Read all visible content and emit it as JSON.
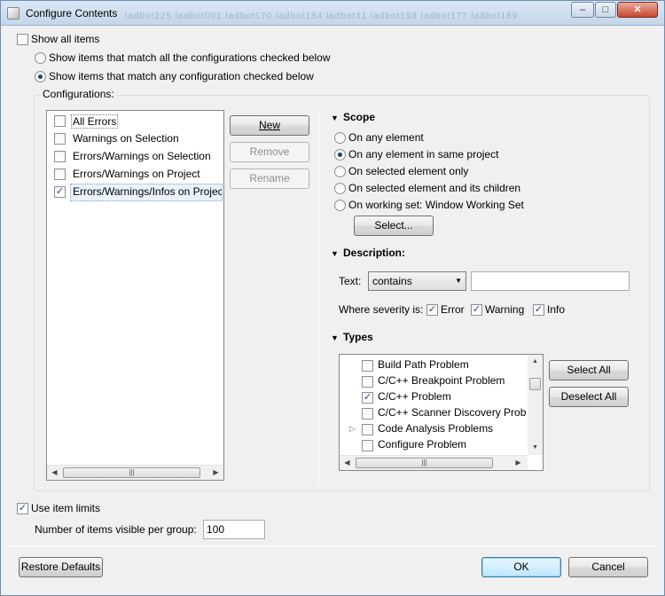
{
  "window": {
    "title": "Configure Contents",
    "ghost_tabs": "ladbot225 ladbot001 ladbot170 ladbot184 ladbot41 ladbot198 ladbot177 ladbot189",
    "controls": {
      "minimize": "–",
      "maximize": "□",
      "close": "✕"
    }
  },
  "show_all": {
    "label": "Show all items",
    "checked": false
  },
  "match_mode": {
    "all_label": "Show items that match all the configurations checked below",
    "any_label": "Show items that match any configuration checked below",
    "selected": "any"
  },
  "configurations": {
    "label": "Configurations:",
    "items": [
      {
        "label": "All Errors",
        "checked": false
      },
      {
        "label": "Warnings on Selection",
        "checked": false
      },
      {
        "label": "Errors/Warnings on Selection",
        "checked": false
      },
      {
        "label": "Errors/Warnings on Project",
        "checked": false
      },
      {
        "label": "Errors/Warnings/Infos on Projec",
        "checked": true
      }
    ],
    "buttons": {
      "new": "New",
      "remove": "Remove",
      "rename": "Rename"
    }
  },
  "scope": {
    "title": "Scope",
    "options": [
      {
        "label": "On any element",
        "selected": false
      },
      {
        "label": "On any element in same project",
        "selected": true
      },
      {
        "label": "On selected element only",
        "selected": false
      },
      {
        "label": "On selected element and its children",
        "selected": false
      },
      {
        "label": "On working set:  Window Working Set",
        "selected": false
      }
    ],
    "select_button": "Select..."
  },
  "description": {
    "title": "Description:",
    "text_label": "Text:",
    "text_mode": "contains",
    "text_value": "",
    "severity_label": "Where severity is:",
    "severities": [
      {
        "label": "Error",
        "checked": true
      },
      {
        "label": "Warning",
        "checked": true
      },
      {
        "label": "Info",
        "checked": true
      }
    ]
  },
  "types": {
    "title": "Types",
    "items": [
      {
        "label": "Build Path Problem",
        "checked": false,
        "expandable": false
      },
      {
        "label": "C/C++ Breakpoint Problem",
        "checked": false,
        "expandable": false
      },
      {
        "label": "C/C++ Problem",
        "checked": true,
        "expandable": false
      },
      {
        "label": "C/C++ Scanner Discovery Probl",
        "checked": false,
        "expandable": false
      },
      {
        "label": "Code Analysis Problems",
        "checked": false,
        "expandable": true
      },
      {
        "label": "Configure Problem",
        "checked": false,
        "expandable": false
      }
    ],
    "select_all": "Select All",
    "deselect_all": "Deselect All"
  },
  "limits": {
    "use_label": "Use item limits",
    "checked": true,
    "count_label": "Number of items visible per group:",
    "count_value": "100"
  },
  "footer": {
    "restore": "Restore Defaults",
    "ok": "OK",
    "cancel": "Cancel"
  },
  "colors": {
    "accent": "#3c7fb1",
    "titlebar": "#c4d6ea"
  }
}
